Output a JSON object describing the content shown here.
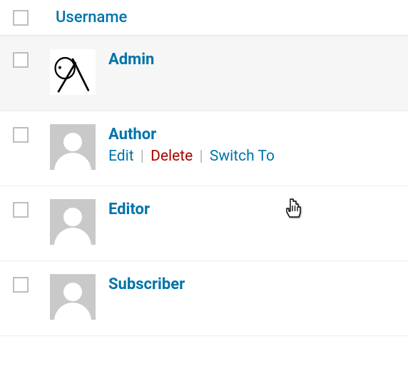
{
  "header": {
    "column_label": "Username"
  },
  "actions": {
    "edit": "Edit",
    "delete": "Delete",
    "switch_to": "Switch To"
  },
  "users": [
    {
      "name": "Admin"
    },
    {
      "name": "Author"
    },
    {
      "name": "Editor"
    },
    {
      "name": "Subscriber"
    }
  ],
  "colors": {
    "link": "#0073aa",
    "delete": "#a00"
  }
}
